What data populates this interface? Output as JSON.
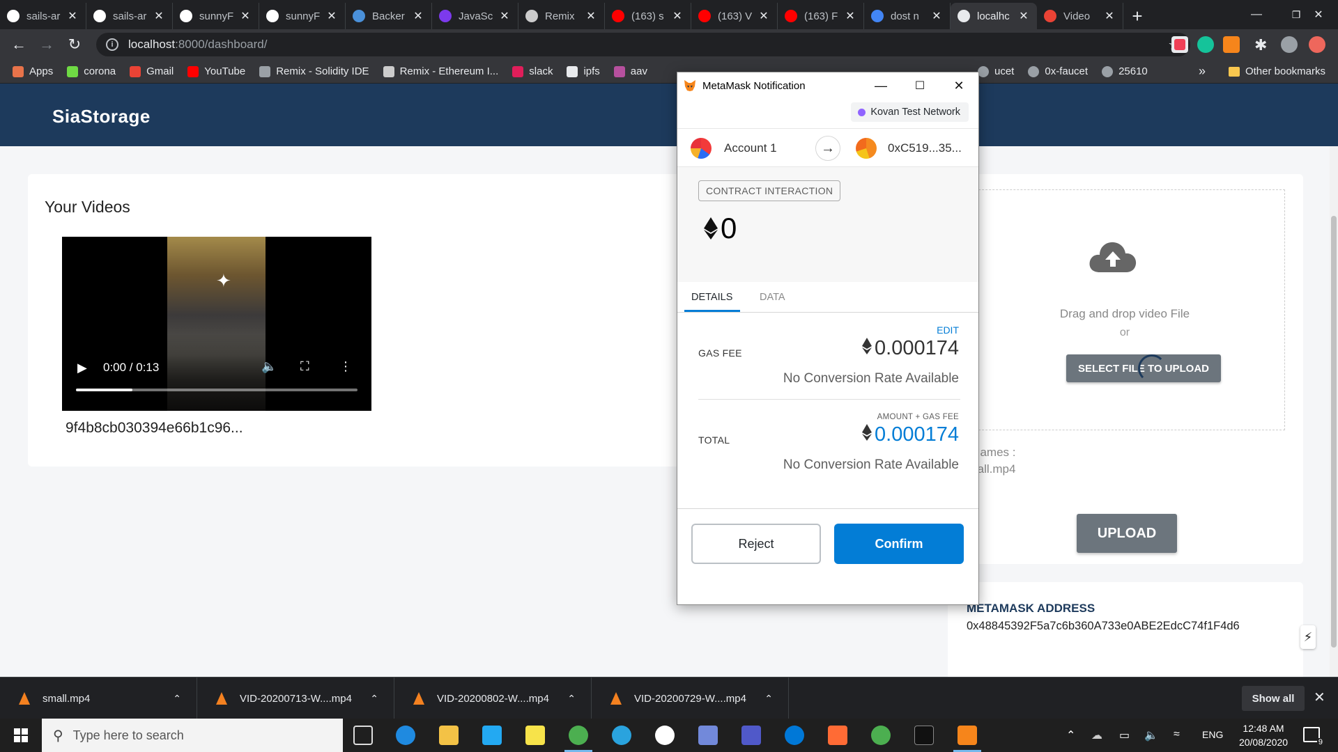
{
  "browser": {
    "tabs": [
      {
        "label": "sails-ar",
        "icon": "github-icon",
        "color": "#ffffff"
      },
      {
        "label": "sails-ar",
        "icon": "github-icon",
        "color": "#ffffff"
      },
      {
        "label": "sunnyF",
        "icon": "github-icon",
        "color": "#ffffff"
      },
      {
        "label": "sunnyF",
        "icon": "github-icon",
        "color": "#ffffff"
      },
      {
        "label": "Backer",
        "icon": "laptop-icon",
        "color": "#4a90d9"
      },
      {
        "label": "JavaSc",
        "icon": "javascript-icon",
        "color": "#7c3aed"
      },
      {
        "label": "Remix",
        "icon": "remix-icon",
        "color": "#cccccc"
      },
      {
        "label": "(163) s",
        "icon": "youtube-icon",
        "color": "#ff0000"
      },
      {
        "label": "(163) V",
        "icon": "youtube-icon",
        "color": "#ff0000"
      },
      {
        "label": "(163) F",
        "icon": "youtube-icon",
        "color": "#ff0000"
      },
      {
        "label": "dost n",
        "icon": "google-icon",
        "color": "#4285f4"
      },
      {
        "label": "localhc",
        "icon": "sia-icon",
        "color": "#e8eaed"
      },
      {
        "label": "Video",
        "icon": "gmail-icon",
        "color": "#ea4335"
      }
    ],
    "active_tab_index": 11,
    "url_host": "localhost",
    "url_path": ":8000/dashboard/",
    "bookmarks": [
      {
        "label": "Apps",
        "icon": "apps-grid-icon",
        "color": "#e8734a"
      },
      {
        "label": "corona",
        "icon": "upwork-icon",
        "color": "#6fda44"
      },
      {
        "label": "Gmail",
        "icon": "gmail-icon",
        "color": "#ea4335"
      },
      {
        "label": "YouTube",
        "icon": "youtube-icon",
        "color": "#ff0000"
      },
      {
        "label": "Remix - Solidity IDE",
        "icon": "ethereum-icon",
        "color": "#9aa0a6"
      },
      {
        "label": "Remix - Ethereum I...",
        "icon": "remix-icon",
        "color": "#cccccc"
      },
      {
        "label": "slack",
        "icon": "slack-icon",
        "color": "#e01e5a"
      },
      {
        "label": "ipfs",
        "icon": "globe-icon",
        "color": "#e8eaed"
      },
      {
        "label": "aav",
        "icon": "aave-icon",
        "color": "#b6509e"
      }
    ],
    "bookmarks_right": [
      {
        "label": "ucet",
        "icon": "clock-icon"
      },
      {
        "label": "0x-faucet",
        "icon": "github-icon"
      },
      {
        "label": "25610",
        "icon": "binance-icon"
      }
    ],
    "other_bookmarks": "Other bookmarks",
    "more_bookmarks": "»"
  },
  "page": {
    "brand": "SiaStorage",
    "videos_title": "Your Videos",
    "video": {
      "time": "0:00 / 0:13",
      "progress_buffered": 0.2,
      "name": "9f4b8cb030394e66b1c96..."
    },
    "upload": {
      "drop_text": "Drag and drop video File",
      "or_text": "or",
      "select_label": "SELECT FILE TO UPLOAD",
      "file_names_label": "e Names :",
      "file_name": "small.mp4",
      "upload_label": "UPLOAD"
    },
    "address": {
      "label": "METAMASK ADDRESS",
      "value": "0x48845392F5a7c6b360A733e0ABE2EdcC74f1F4d6"
    }
  },
  "metamask": {
    "window_title": "MetaMask Notification",
    "network": "Kovan Test Network",
    "network_color": "#9064ff",
    "from_account": "Account 1",
    "to_address": "0xC519...35...",
    "action": "CONTRACT INTERACTION",
    "amount": "0",
    "tabs": [
      "DETAILS",
      "DATA"
    ],
    "active_tab": "DETAILS",
    "edit_label": "EDIT",
    "gas_fee_label": "GAS FEE",
    "gas_fee_value": "0.000174",
    "gas_fee_conversion": "No Conversion Rate Available",
    "amount_gas_label": "AMOUNT + GAS FEE",
    "total_label": "TOTAL",
    "total_value": "0.000174",
    "total_conversion": "No Conversion Rate Available",
    "reject_label": "Reject",
    "confirm_label": "Confirm",
    "accent_color": "#037dd6"
  },
  "downloads": {
    "items": [
      "small.mp4",
      "VID-20200713-W....mp4",
      "VID-20200802-W....mp4",
      "VID-20200729-W....mp4"
    ],
    "show_all": "Show all"
  },
  "taskbar": {
    "search_placeholder": "Type here to search",
    "language": "ENG",
    "time": "12:48 AM",
    "date": "20/08/2020",
    "notifications": "9"
  }
}
